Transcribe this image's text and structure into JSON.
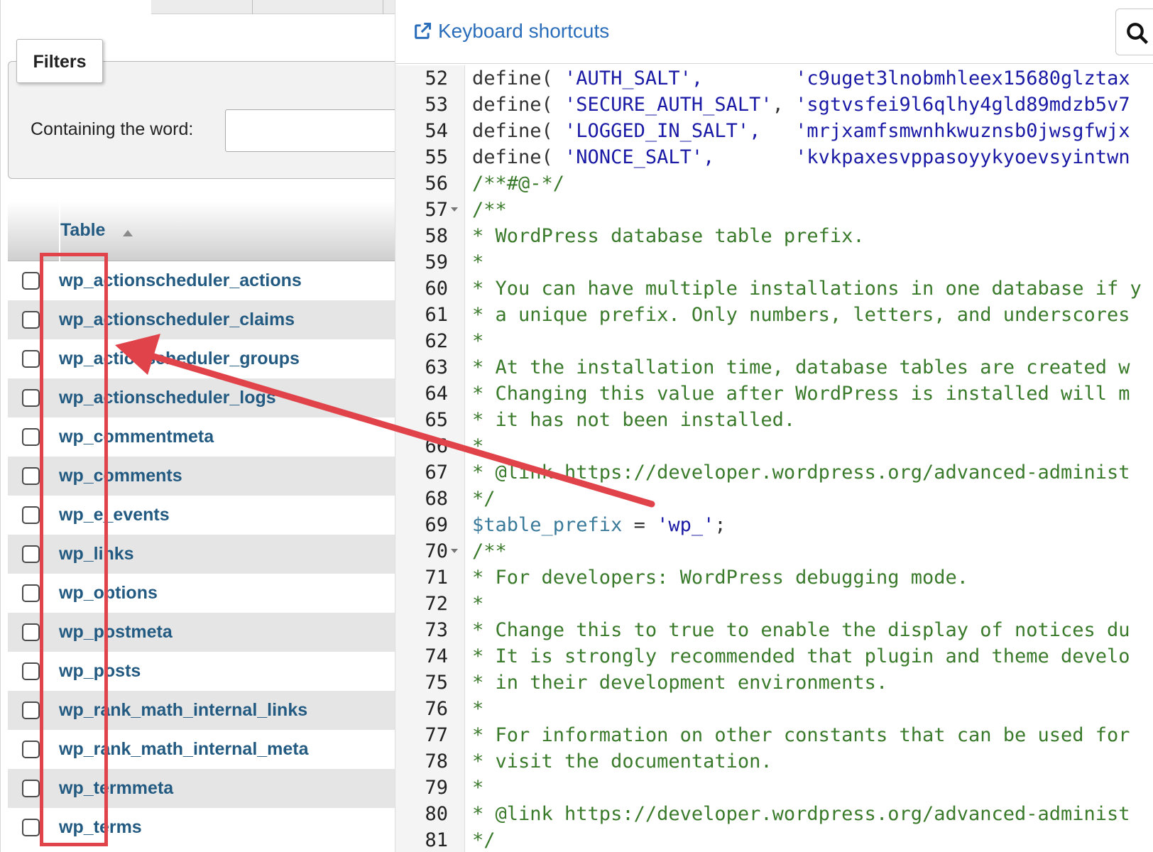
{
  "filters": {
    "legend": "Filters",
    "containing_label": "Containing the word:",
    "input_value": ""
  },
  "table": {
    "header": "Table",
    "rows": [
      "wp_actionscheduler_actions",
      "wp_actionscheduler_claims",
      "wp_actionscheduler_groups",
      "wp_actionscheduler_logs",
      "wp_commentmeta",
      "wp_comments",
      "wp_e_events",
      "wp_links",
      "wp_options",
      "wp_postmeta",
      "wp_posts",
      "wp_rank_math_internal_links",
      "wp_rank_math_internal_meta",
      "wp_termmeta",
      "wp_terms"
    ]
  },
  "editor": {
    "shortcuts_label": "Keyboard shortcuts",
    "lines": [
      {
        "n": "52",
        "fold": false,
        "parts": [
          [
            "kw",
            "define( "
          ],
          [
            "str",
            "'AUTH_SALT',"
          ],
          [
            "kw",
            "        "
          ],
          [
            "str",
            "'c9uget3lnobmhleex15680glztax"
          ]
        ]
      },
      {
        "n": "53",
        "fold": false,
        "parts": [
          [
            "kw",
            "define( "
          ],
          [
            "str",
            "'SECURE_AUTH_SALT'"
          ],
          [
            "kw",
            ", "
          ],
          [
            "str",
            "'sgtvsfei9l6qlhy4gld89mdzb5v7"
          ]
        ]
      },
      {
        "n": "54",
        "fold": false,
        "parts": [
          [
            "kw",
            "define( "
          ],
          [
            "str",
            "'LOGGED_IN_SALT',"
          ],
          [
            "kw",
            "   "
          ],
          [
            "str",
            "'mrjxamfsmwnhkwuznsb0jwsgfwjx"
          ]
        ]
      },
      {
        "n": "55",
        "fold": false,
        "parts": [
          [
            "kw",
            "define( "
          ],
          [
            "str",
            "'NONCE_SALT',"
          ],
          [
            "kw",
            "       "
          ],
          [
            "str",
            "'kvkpaxesvppasoyykyoevsyintwn"
          ]
        ]
      },
      {
        "n": "56",
        "fold": false,
        "parts": [
          [
            "com",
            "/**#@-*/"
          ]
        ]
      },
      {
        "n": "57",
        "fold": true,
        "parts": [
          [
            "com",
            "/**"
          ]
        ]
      },
      {
        "n": "58",
        "fold": false,
        "parts": [
          [
            "com",
            "* WordPress database table prefix."
          ]
        ]
      },
      {
        "n": "59",
        "fold": false,
        "parts": [
          [
            "com",
            "*"
          ]
        ]
      },
      {
        "n": "60",
        "fold": false,
        "parts": [
          [
            "com",
            "* You can have multiple installations in one database if y"
          ]
        ]
      },
      {
        "n": "61",
        "fold": false,
        "parts": [
          [
            "com",
            "* a unique prefix. Only numbers, letters, and underscores"
          ]
        ]
      },
      {
        "n": "62",
        "fold": false,
        "parts": [
          [
            "com",
            "*"
          ]
        ]
      },
      {
        "n": "63",
        "fold": false,
        "parts": [
          [
            "com",
            "* At the installation time, database tables are created w"
          ]
        ]
      },
      {
        "n": "64",
        "fold": false,
        "parts": [
          [
            "com",
            "* Changing this value after WordPress is installed will m"
          ]
        ]
      },
      {
        "n": "65",
        "fold": false,
        "parts": [
          [
            "com",
            "* it has not been installed."
          ]
        ]
      },
      {
        "n": "66",
        "fold": false,
        "parts": [
          [
            "com",
            "*"
          ]
        ]
      },
      {
        "n": "67",
        "fold": false,
        "parts": [
          [
            "com",
            "* @link https://developer.wordpress.org/advanced-administ"
          ]
        ]
      },
      {
        "n": "68",
        "fold": false,
        "parts": [
          [
            "com",
            "*/"
          ]
        ]
      },
      {
        "n": "69",
        "fold": false,
        "parts": [
          [
            "var",
            "$table_prefix"
          ],
          [
            "kw",
            " = "
          ],
          [
            "str",
            "'wp_'"
          ],
          [
            "kw",
            ";"
          ]
        ]
      },
      {
        "n": "70",
        "fold": true,
        "parts": [
          [
            "com",
            "/**"
          ]
        ]
      },
      {
        "n": "71",
        "fold": false,
        "parts": [
          [
            "com",
            "* For developers: WordPress debugging mode."
          ]
        ]
      },
      {
        "n": "72",
        "fold": false,
        "parts": [
          [
            "com",
            "*"
          ]
        ]
      },
      {
        "n": "73",
        "fold": false,
        "parts": [
          [
            "com",
            "* Change this to true to enable the display of notices du"
          ]
        ]
      },
      {
        "n": "74",
        "fold": false,
        "parts": [
          [
            "com",
            "* It is strongly recommended that plugin and theme develo"
          ]
        ]
      },
      {
        "n": "75",
        "fold": false,
        "parts": [
          [
            "com",
            "* in their development environments."
          ]
        ]
      },
      {
        "n": "76",
        "fold": false,
        "parts": [
          [
            "com",
            "*"
          ]
        ]
      },
      {
        "n": "77",
        "fold": false,
        "parts": [
          [
            "com",
            "* For information on other constants that can be used for"
          ]
        ]
      },
      {
        "n": "78",
        "fold": false,
        "parts": [
          [
            "com",
            "* visit the documentation."
          ]
        ]
      },
      {
        "n": "79",
        "fold": false,
        "parts": [
          [
            "com",
            "*"
          ]
        ]
      },
      {
        "n": "80",
        "fold": false,
        "parts": [
          [
            "com",
            "* @link https://developer.wordpress.org/advanced-administ"
          ]
        ]
      },
      {
        "n": "81",
        "fold": false,
        "parts": [
          [
            "com",
            "*/"
          ]
        ]
      }
    ]
  },
  "icons": {
    "external_link": "external-link-icon",
    "search": "search-icon",
    "sort": "sort-asc-icon"
  },
  "colors": {
    "link": "#235a81",
    "shortcut_link": "#2a6ebb",
    "annotation": "#e0434a",
    "string": "#1a1aa6",
    "comment": "#3a7a2b"
  }
}
